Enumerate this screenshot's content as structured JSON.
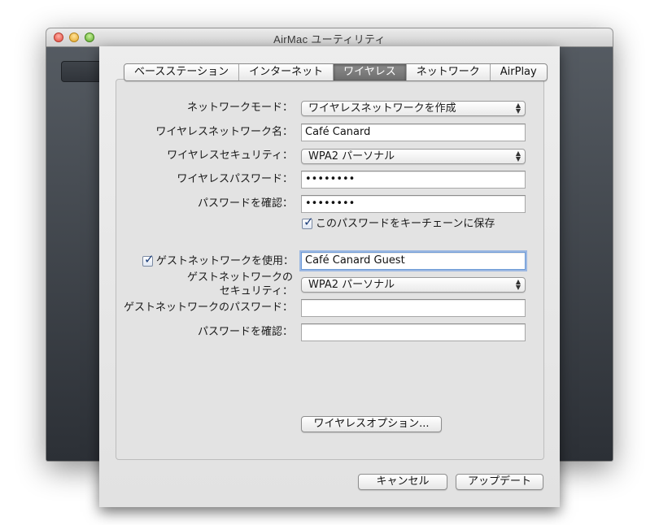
{
  "window": {
    "title": "AirMac ユーティリティ"
  },
  "tabs": [
    {
      "label": "ベースステーション",
      "active": false
    },
    {
      "label": "インターネット",
      "active": false
    },
    {
      "label": "ワイヤレス",
      "active": true
    },
    {
      "label": "ネットワーク",
      "active": false
    },
    {
      "label": "AirPlay",
      "active": false
    }
  ],
  "wireless": {
    "network_mode_label": "ネットワークモード：",
    "network_mode_value": "ワイヤレスネットワークを作成",
    "network_name_label": "ワイヤレスネットワーク名：",
    "network_name_value": "Café Canard",
    "security_label": "ワイヤレスセキュリティ：",
    "security_value": "WPA2 パーソナル",
    "password_label": "ワイヤレスパスワード：",
    "password_value": "••••••••",
    "confirm_label": "パスワードを確認：",
    "confirm_value": "••••••••",
    "keychain_label": "このパスワードをキーチェーンに保存",
    "keychain_checked": true
  },
  "guest": {
    "use_label": "ゲストネットワークを使用：",
    "use_checked": true,
    "name_value": "Café Canard Guest",
    "security_label_line1": "ゲストネットワークの",
    "security_label_line2": "セキュリティ：",
    "security_value": "WPA2 パーソナル",
    "password_label": "ゲストネットワークのパスワード：",
    "password_value": "",
    "confirm_label": "パスワードを確認：",
    "confirm_value": ""
  },
  "buttons": {
    "wireless_options": "ワイヤレスオプション...",
    "cancel": "キャンセル",
    "update": "アップデート"
  },
  "icons": {
    "check": "✓",
    "popup_arrows": "▲▼"
  }
}
